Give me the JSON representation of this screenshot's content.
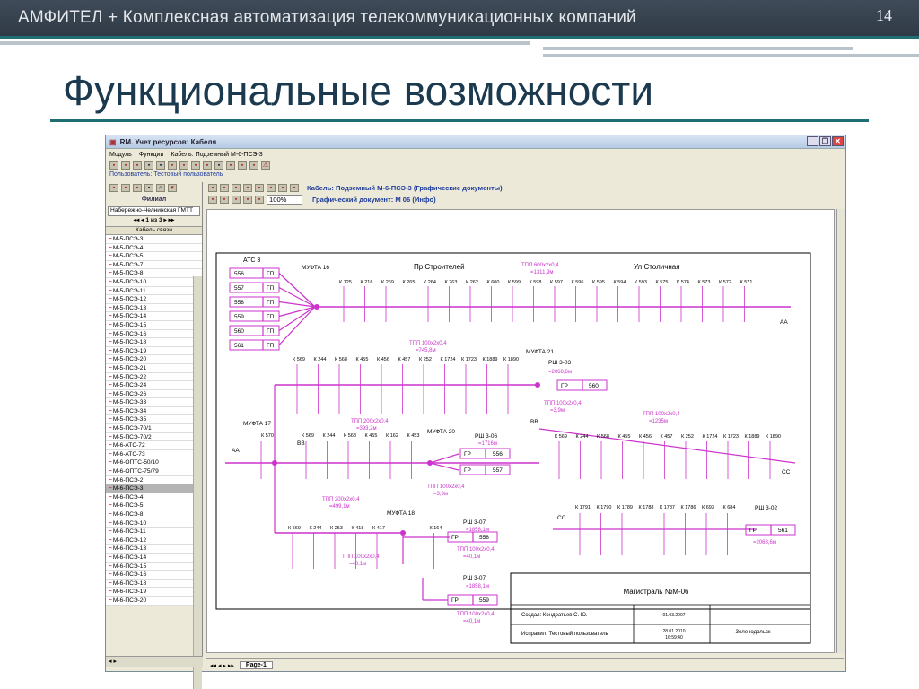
{
  "slide": {
    "header": "АМФИТЕЛ + Комплексная автоматизация телекоммуникационных компаний",
    "page_number": "14",
    "heading": "Функциональные возможности"
  },
  "window": {
    "title": "RM. Учет ресурсов: Кабеля",
    "menu": [
      "Модуль",
      "Функции",
      "Кабель: Подземный М-6-ПСЭ-3"
    ],
    "user_label": "Пользователь: Тестовый пользователь",
    "branch_label": "Филиал",
    "branch_value": "Набережно-Челнинская ГМТТ",
    "pager": "1 из 3",
    "list_header": "Кабель связи",
    "cable_label": "Кабель: Подземный М-6-ПСЭ-3 (Графические документы)",
    "zoom": "100%",
    "doc_label": "Графический документ: М 06 (Инфо)",
    "page_tab": "Page-1"
  },
  "cables": [
    "М-5-ПСЭ-3",
    "М-5-ПСЭ-4",
    "М-5-ПСЭ-5",
    "М-5-ПСЭ-7",
    "М-5-ПСЭ-8",
    "М-5-ПСЭ-10",
    "М-5-ПСЭ-11",
    "М-5-ПСЭ-12",
    "М-5-ПСЭ-13",
    "М-5-ПСЭ-14",
    "М-5-ПСЭ-15",
    "М-5-ПСЭ-16",
    "М-5-ПСЭ-18",
    "М-5-ПСЭ-19",
    "М-5-ПСЭ-20",
    "М-5-ПСЭ-21",
    "М-5-ПСЭ-22",
    "М-5-ПСЭ-24",
    "М-5-ПСЭ-26",
    "М-5-ПСЭ-33",
    "М-5-ПСЭ-34",
    "М-5-ПСЭ-35",
    "М-5-ПСЭ-70/1",
    "М-5-ПСЭ-70/2",
    "М-6-АТС-72",
    "М-6-АТС-73",
    "М-6-ОПТС-50/10",
    "М-6-ОПТС-75/79",
    "М-6-ПСЭ-2",
    "М-6-ПСЭ-3",
    "М-6-ПСЭ-4",
    "М-6-ПСЭ-5",
    "М-6-ПСЭ-8",
    "М-6-ПСЭ-10",
    "М-6-ПСЭ-11",
    "М-6-ПСЭ-12",
    "М-6-ПСЭ-13",
    "М-6-ПСЭ-14",
    "М-6-ПСЭ-15",
    "М-6-ПСЭ-16",
    "М-6-ПСЭ-18",
    "М-6-ПСЭ-19",
    "М-6-ПСЭ-20"
  ],
  "selected_cable": "М-6-ПСЭ-3",
  "diagram": {
    "ats": "АТС 3",
    "ats_ports": [
      "556",
      "557",
      "558",
      "559",
      "560",
      "561"
    ],
    "port_code": "ГП",
    "muftas": [
      "МУФТА 16",
      "МУФТА 21",
      "МУФТА 17",
      "МУФТА 20",
      "МУФТА 18"
    ],
    "streets": [
      "Пр.Строителей",
      "Ул.Столичная"
    ],
    "tpp_main": [
      "ТПП 600х2х0,4",
      "=1311,9м"
    ],
    "tpp_a": [
      "ТПП 100х2х0,4",
      "=745,8м"
    ],
    "tpp_b": [
      "ТПП 100х2х0,4",
      "=1235м"
    ],
    "tpp_c": [
      "ТПП 200х2х0,4",
      "=393,2м"
    ],
    "tpp_d": [
      "ТПП 200х2х0,4",
      "=499,1м"
    ],
    "tpp_e": [
      "ТПП 100х2х0,4",
      "=3,9м"
    ],
    "tpp_f": [
      "ТПП 100х2х0,4",
      "=3,9м"
    ],
    "tpp_g": [
      "ТПП 100х2х0,4",
      "=40,1м"
    ],
    "tpp_h": [
      "ТПП 100х2х0,4",
      "=40,1м"
    ],
    "tpp_i": [
      "ТПП 100х2х0,4",
      "=40,1м"
    ],
    "rsh": [
      "РШ 3-03",
      "РШ 3-06",
      "РШ 3-07",
      "РШ 3-07",
      "РШ 3-02"
    ],
    "rsh_len": [
      "=2068,6м",
      "=1716м",
      "=1858,1м",
      "=1858,1м",
      "=2068,6м"
    ],
    "rsh_ports": [
      "560",
      "556",
      "557",
      "558",
      "559",
      "561"
    ],
    "gr": "ГР",
    "nodes": [
      "АА",
      "ВВ",
      "СС"
    ],
    "row1": [
      "К 125",
      "К 216",
      "К 269",
      "К 265",
      "К 264",
      "К 263",
      "К 262",
      "К 600",
      "К 599",
      "К 598",
      "К 597",
      "К 596",
      "К 595",
      "К 594",
      "К 593",
      "К 575",
      "К 574",
      "К 573",
      "К 572",
      "К 571"
    ],
    "row2": [
      "К 569",
      "К 244",
      "К 568",
      "К 455",
      "К 456",
      "К 457",
      "К 252",
      "К 1724",
      "К 1723",
      "К 1889",
      "К 1890"
    ],
    "row3a": [
      "К 570"
    ],
    "row3b": [
      "К 569",
      "К 244",
      "К 568",
      "К 455",
      "К 162",
      "К 453"
    ],
    "row3c": [
      "К 569",
      "К 244",
      "К 568",
      "К 455",
      "К 456",
      "К 457",
      "К 252",
      "К 1724",
      "К 1723",
      "К 1889",
      "К 1890"
    ],
    "row4a": [
      "К 569",
      "К 244",
      "К 253",
      "К 418",
      "К 417",
      "К 164"
    ],
    "row4b": [
      "К 1791",
      "К 1790",
      "К 1789",
      "К 1788",
      "К 1787",
      "К 1786",
      "К 693",
      "К 684"
    ],
    "stamp_title": "Магистраль №М-06",
    "created_label": "Создал: Кондратьев С. Ю.",
    "edited_label": "Исправил: Тестовый пользователь",
    "created_date": "01.03.2007",
    "edited_date": "28.01.2010",
    "edited_time": "16:59:40",
    "city": "Зеленодольск"
  },
  "colors": {
    "accent": "#1f6f72",
    "line": "#cc33cc",
    "title": "#1b3a4f"
  }
}
